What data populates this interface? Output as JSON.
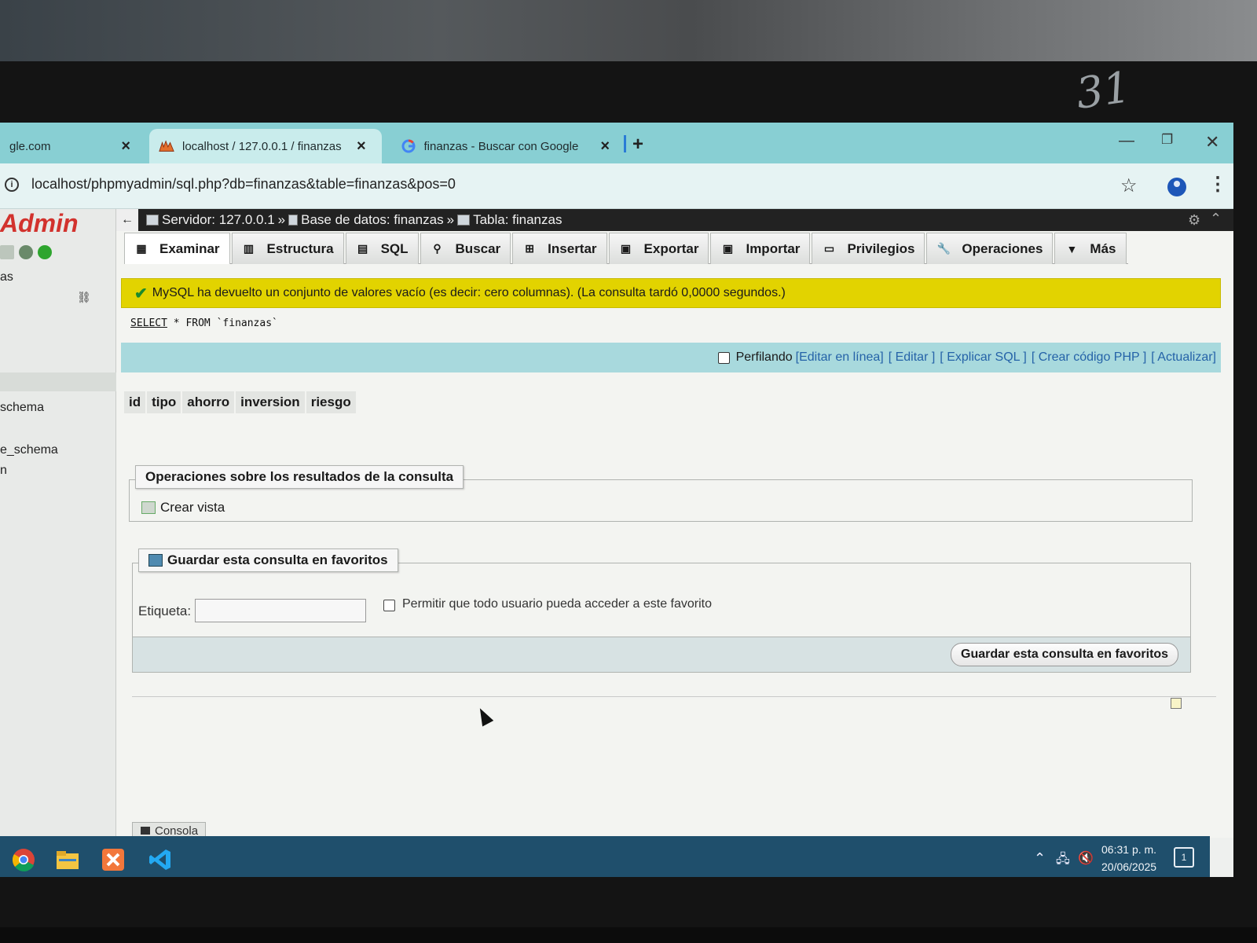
{
  "photo": {
    "bezel_mark": "31"
  },
  "browser": {
    "tabs": [
      {
        "title": "gle.com",
        "close": "×"
      },
      {
        "title": "localhost / 127.0.0.1 / finanzas",
        "close": "×"
      },
      {
        "title": "finanzas - Buscar con Google",
        "close": "×"
      }
    ],
    "new_tab": "+",
    "url": "localhost/phpmyadmin/sql.php?db=finanzas&table=finanzas&pos=0"
  },
  "sidebar": {
    "logo": "Admin",
    "items": [
      "as",
      "schema",
      "e_schema",
      "n"
    ]
  },
  "breadcrumb": {
    "back": "←",
    "server": "Servidor: 127.0.0.1",
    "database": "Base de datos: finanzas",
    "table": "Tabla: finanzas",
    "sep": "»"
  },
  "tabs": [
    {
      "label": "Examinar",
      "icon": "browse-icon"
    },
    {
      "label": "Estructura",
      "icon": "structure-icon"
    },
    {
      "label": "SQL",
      "icon": "sql-icon"
    },
    {
      "label": "Buscar",
      "icon": "search-icon"
    },
    {
      "label": "Insertar",
      "icon": "insert-icon"
    },
    {
      "label": "Exportar",
      "icon": "export-icon"
    },
    {
      "label": "Importar",
      "icon": "import-icon"
    },
    {
      "label": "Privilegios",
      "icon": "privileges-icon"
    },
    {
      "label": "Operaciones",
      "icon": "wrench-icon"
    },
    {
      "label": "Más",
      "icon": "caret-down-icon"
    }
  ],
  "notice": "MySQL ha devuelto un conjunto de valores vacío (es decir: cero columnas). (La consulta tardó 0,0000 segundos.)",
  "sql": {
    "keyword": "SELECT",
    "rest": "* FROM `finanzas`"
  },
  "sql_actions": {
    "profiling": "Perfilando",
    "edit_inline": "[Editar en línea]",
    "edit": "[ Editar ]",
    "explain": "[ Explicar SQL ]",
    "php": "[ Crear código PHP ]",
    "refresh": "[ Actualizar]"
  },
  "columns": [
    "id",
    "tipo",
    "ahorro",
    "inversion",
    "riesgo"
  ],
  "query_ops": {
    "legend": "Operaciones sobre los resultados de la consulta",
    "create_view": "Crear vista"
  },
  "favorites": {
    "legend": "Guardar esta consulta en favoritos",
    "label": "Etiqueta:",
    "input_value": "",
    "allow_all": "Permitir que todo usuario pueda acceder a este favorito",
    "button": "Guardar esta consulta en favoritos"
  },
  "console": "Consola",
  "taskbar": {
    "time": "06:31 p. m.",
    "date": "20/06/2025",
    "notify_count": "1"
  },
  "colors": {
    "tabbar": "#88cfd3",
    "notice_bg": "#e2d300",
    "sql_strip": "#a8d9dd",
    "taskbar": "#1f4f6c",
    "logo_red": "#d2322d",
    "link_blue": "#2563a8"
  }
}
